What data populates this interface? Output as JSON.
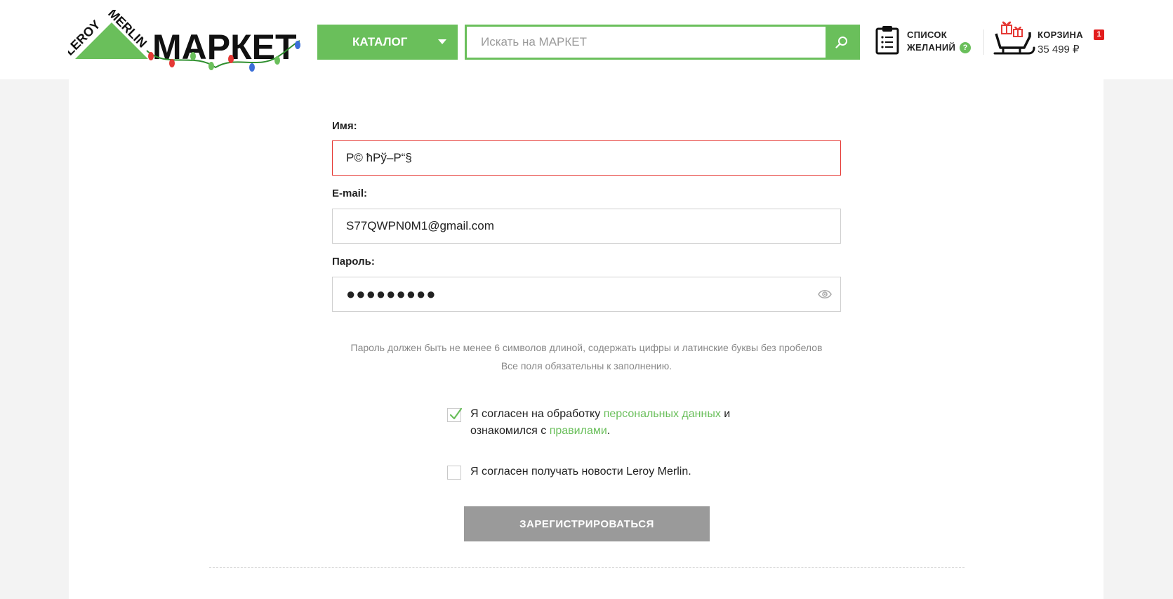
{
  "header": {
    "logo": {
      "brand_top": "LEROY",
      "brand_side": "MERLIN",
      "wordmark": "МАРКЕТ"
    },
    "catalog_label": "КАТАЛОГ",
    "search": {
      "placeholder": "Искать на МАРКЕТ",
      "value": ""
    },
    "wishlist": {
      "line1": "СПИСОК",
      "line2": "ЖЕЛАНИЙ",
      "help": "?"
    },
    "cart": {
      "label": "КОРЗИНА",
      "total": "35 499 ₽",
      "count": "1"
    }
  },
  "form": {
    "name": {
      "label": "Имя:",
      "value": "Р© ћРў–Р“§",
      "state": "error"
    },
    "email": {
      "label": "E-mail:",
      "value": "S77QWPN0M1@gmail.com"
    },
    "password": {
      "label": "Пароль:",
      "value": "●●●●●●●●●"
    },
    "hint_line1": "Пароль должен быть не менее 6 символов длиной, содержать цифры и латинские буквы без пробелов",
    "hint_line2": "Все поля обязательны к заполнению.",
    "consent": {
      "checked": true,
      "text_before": "Я согласен на обработку ",
      "link1": "персональных данных",
      "text_mid": " и",
      "text_line2": "ознакомился с ",
      "link2": "правилами",
      "text_end": "."
    },
    "newsletter": {
      "checked": false,
      "text": "Я согласен получать новости Leroy Merlin."
    },
    "submit_label": "ЗАРЕГИСТРИРОВАТЬСЯ"
  },
  "colors": {
    "accent": "#6abf5b",
    "error": "#e53935",
    "badge": "#e21d1d",
    "submit_disabled": "#9a9a9a"
  }
}
